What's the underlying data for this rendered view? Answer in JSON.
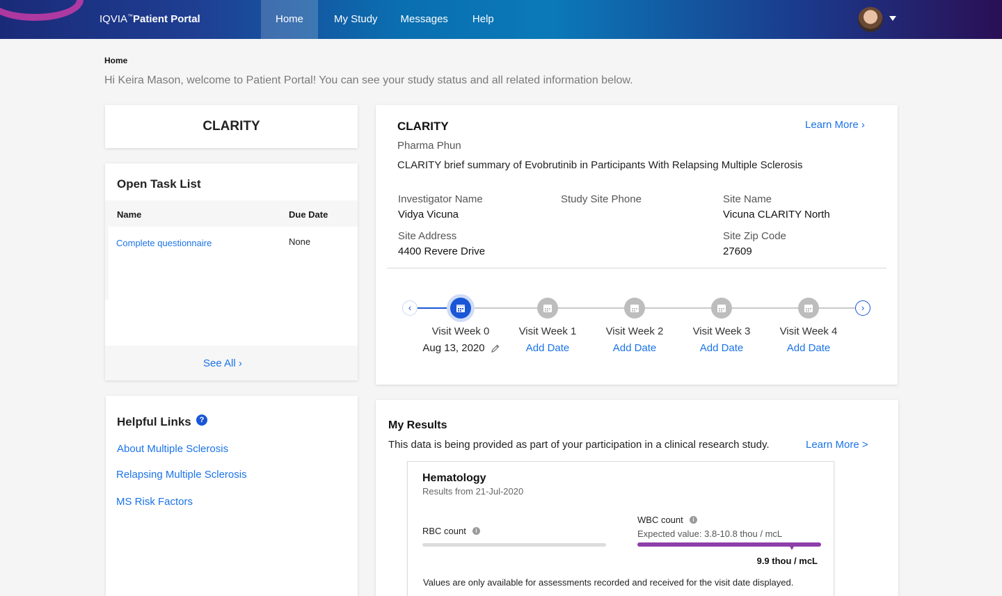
{
  "header": {
    "brand_prefix": "IQVIA",
    "brand_tm": "™",
    "brand_name": "Patient Portal",
    "nav": [
      "Home",
      "My Study",
      "Messages",
      "Help"
    ],
    "active_nav": "Home"
  },
  "breadcrumb": "Home",
  "welcome": "Hi Keira Mason, welcome to Patient Portal! You can see your study status and all related information below.",
  "study_card": {
    "name": "CLARITY"
  },
  "tasks": {
    "title": "Open Task List",
    "columns": [
      "Name",
      "Due Date"
    ],
    "rows": [
      {
        "name": "Complete questionnaire",
        "due": "None"
      }
    ],
    "see_all": "See All ›"
  },
  "helpful_links": {
    "title": "Helpful Links",
    "help_icon": "?",
    "links": [
      "About Multiple Sclerosis",
      "Relapsing Multiple Sclerosis",
      "MS Risk Factors"
    ]
  },
  "study": {
    "title": "CLARITY",
    "learn_more": "Learn More ›",
    "sponsor": "Pharma Phun",
    "summary": "CLARITY brief summary of Evobrutinib in Participants With Relapsing Multiple Sclerosis",
    "investigator_label": "Investigator Name",
    "investigator_value": "Vidya Vicuna",
    "phone_label": "Study Site Phone",
    "site_name_label": "Site Name",
    "site_name_value": "Vicuna CLARITY North",
    "address_label": "Site Address",
    "address_value": "4400 Revere Drive",
    "zip_label": "Site Zip Code",
    "zip_value": "27609"
  },
  "timeline": {
    "prev_icon": "‹",
    "next_icon": "›",
    "visits": [
      {
        "label": "Visit Week 0",
        "date": "Aug 13, 2020",
        "active": true
      },
      {
        "label": "Visit Week 1",
        "date": "Add Date",
        "active": false
      },
      {
        "label": "Visit Week 2",
        "date": "Add Date",
        "active": false
      },
      {
        "label": "Visit Week 3",
        "date": "Add Date",
        "active": false
      },
      {
        "label": "Visit Week 4",
        "date": "Add Date",
        "active": false
      }
    ]
  },
  "results": {
    "title": "My Results",
    "description": "This data is being provided as part of your participation in a clinical research study.",
    "learn_more": "Learn More >",
    "panel": {
      "title": "Hematology",
      "subtitle": "Results from 21-Jul-2020",
      "rbc_label": "RBC count",
      "wbc_label": "WBC count",
      "info_icon": "i",
      "wbc_expected": "Expected value: 3.8-10.8 thou / mcL",
      "wbc_value": "9.9 thou / mcL",
      "wbc_level_percent": 84,
      "note": "Values are only available for assessments recorded and received for the visit date displayed."
    }
  },
  "colors": {
    "accent": "#1a56d6",
    "link": "#1a73e8",
    "result_bar": "#8e3ea8"
  }
}
